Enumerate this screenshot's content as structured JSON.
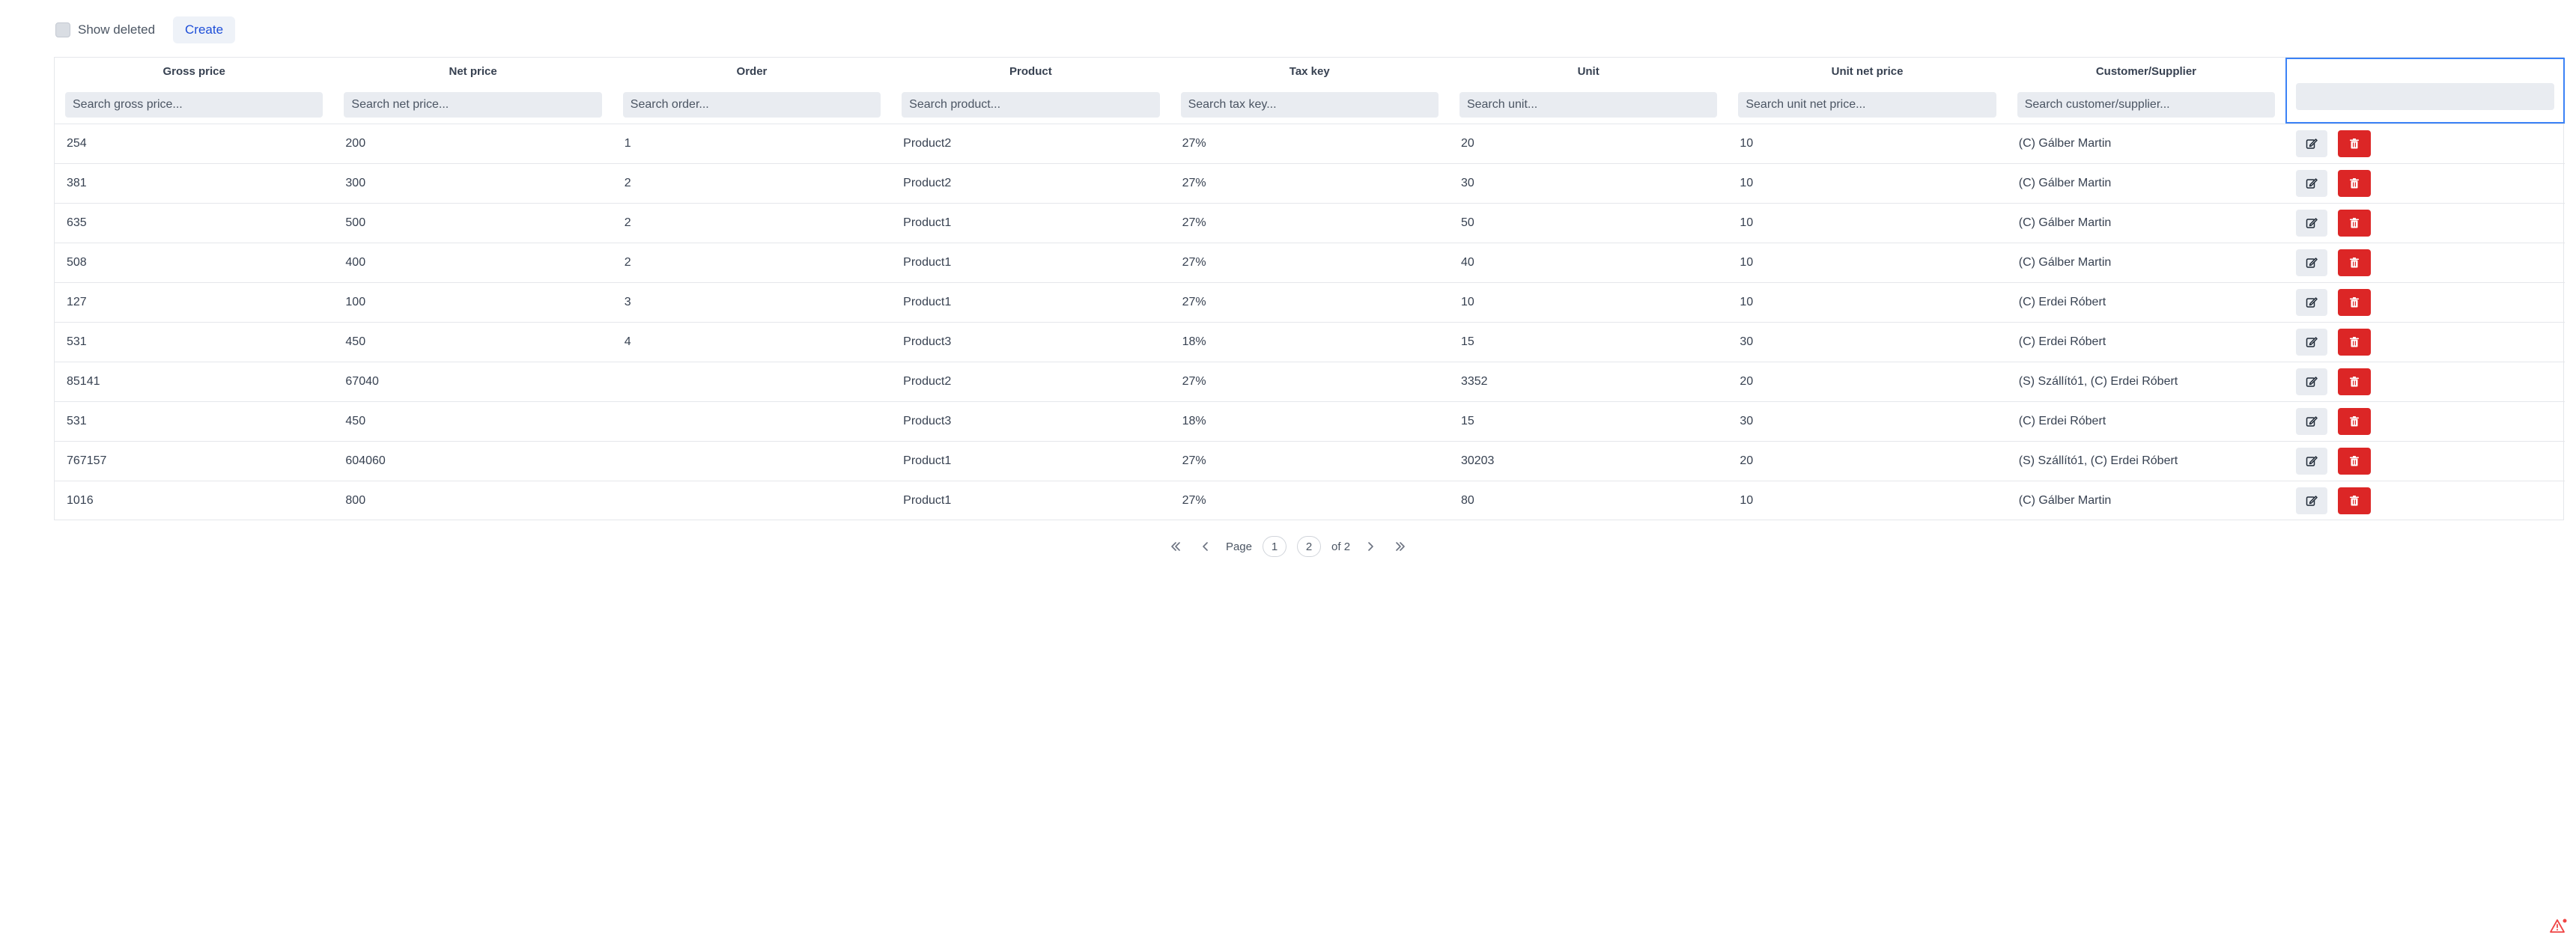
{
  "toolbar": {
    "show_deleted_label": "Show deleted",
    "create_label": "Create"
  },
  "table": {
    "columns": [
      {
        "label": "Gross price",
        "placeholder": "Search gross price..."
      },
      {
        "label": "Net price",
        "placeholder": "Search net price..."
      },
      {
        "label": "Order",
        "placeholder": "Search order..."
      },
      {
        "label": "Product",
        "placeholder": "Search product..."
      },
      {
        "label": "Tax key",
        "placeholder": "Search tax key..."
      },
      {
        "label": "Unit",
        "placeholder": "Search unit..."
      },
      {
        "label": "Unit net price",
        "placeholder": "Search unit net price..."
      },
      {
        "label": "Customer/Supplier",
        "placeholder": "Search customer/supplier..."
      }
    ],
    "rows": [
      [
        "254",
        "200",
        "1",
        "Product2",
        "27%",
        "20",
        "10",
        "(C) Gálber Martin"
      ],
      [
        "381",
        "300",
        "2",
        "Product2",
        "27%",
        "30",
        "10",
        "(C) Gálber Martin"
      ],
      [
        "635",
        "500",
        "2",
        "Product1",
        "27%",
        "50",
        "10",
        "(C) Gálber Martin"
      ],
      [
        "508",
        "400",
        "2",
        "Product1",
        "27%",
        "40",
        "10",
        "(C) Gálber Martin"
      ],
      [
        "127",
        "100",
        "3",
        "Product1",
        "27%",
        "10",
        "10",
        "(C) Erdei Róbert"
      ],
      [
        "531",
        "450",
        "4",
        "Product3",
        "18%",
        "15",
        "30",
        "(C) Erdei Róbert"
      ],
      [
        "85141",
        "67040",
        "",
        "Product2",
        "27%",
        "3352",
        "20",
        "(S) Szállító1, (C) Erdei Róbert"
      ],
      [
        "531",
        "450",
        "",
        "Product3",
        "18%",
        "15",
        "30",
        "(C) Erdei Róbert"
      ],
      [
        "767157",
        "604060",
        "",
        "Product1",
        "27%",
        "30203",
        "20",
        "(S) Szállító1, (C) Erdei Róbert"
      ],
      [
        "1016",
        "800",
        "",
        "Product1",
        "27%",
        "80",
        "10",
        "(C) Gálber Martin"
      ]
    ]
  },
  "icons": {
    "edit": "edit-icon",
    "delete": "trash-icon",
    "first": "chevrons-left-icon",
    "prev": "chevron-left-icon",
    "next": "chevron-right-icon",
    "last": "chevrons-right-icon",
    "corner": "warning-icon"
  },
  "pagination": {
    "page_label": "Page",
    "pages": [
      "1",
      "2"
    ],
    "of_label": "of",
    "total": "2"
  },
  "colors": {
    "accent": "#1d4ed8",
    "danger": "#dc2626",
    "focus": "#3b82f6"
  }
}
